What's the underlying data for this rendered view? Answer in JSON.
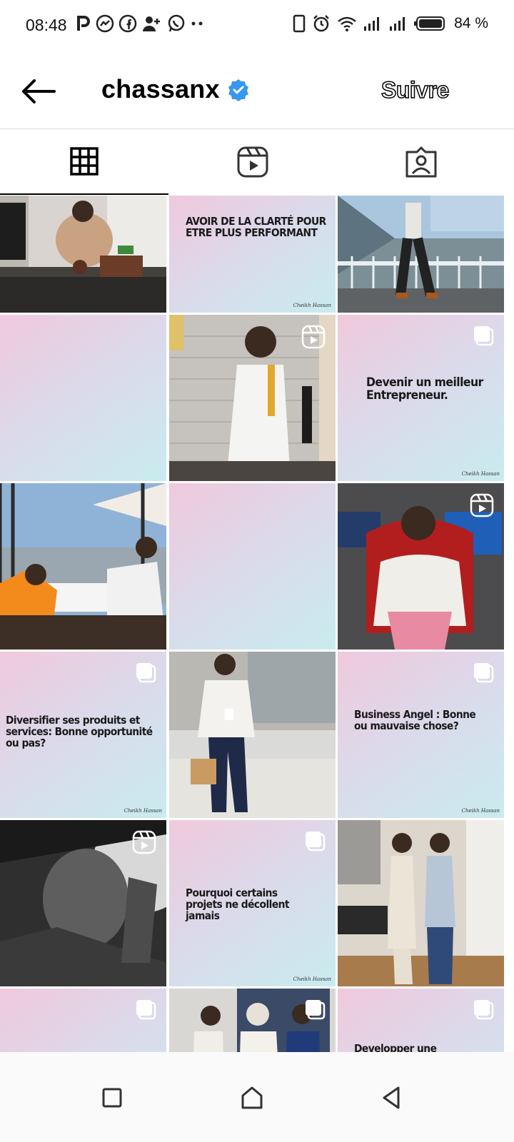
{
  "status_bar": {
    "time": "08:48",
    "battery_percent": "84 %",
    "left_icons": [
      "parking-app-icon",
      "messenger-icon",
      "facebook-icon",
      "add-contact-icon",
      "whatsapp-icon",
      "more-dots-icon"
    ],
    "right_icons": [
      "vibrate-icon",
      "alarm-icon",
      "wifi-icon",
      "signal-icon",
      "signal-icon",
      "battery-icon"
    ]
  },
  "header": {
    "username": "chassanx",
    "verified": true,
    "follow_label": "Suivre"
  },
  "tabs": [
    {
      "name": "tab-posts",
      "icon": "grid-icon",
      "active": true
    },
    {
      "name": "tab-reels",
      "icon": "reels-icon",
      "active": false
    },
    {
      "name": "tab-tagged",
      "icon": "tagged-icon",
      "active": false
    }
  ],
  "grid": {
    "posts": [
      {
        "kind": "photo",
        "subject": "man at office desk"
      },
      {
        "kind": "card",
        "text": "AVOIR DE LA CLARTÉ POUR ETRE PLUS PERFORMANT",
        "signature": "Cheikh Hassan"
      },
      {
        "kind": "photo",
        "subject": "man walking on bridge"
      },
      {
        "kind": "card",
        "text": "",
        "signature": ""
      },
      {
        "kind": "reel",
        "subject": "man in white outfit with microphone"
      },
      {
        "kind": "card",
        "text": "Devenir un meilleur Entrepreneur.",
        "signature": "Cheikh Hassan",
        "multi": true
      },
      {
        "kind": "photo",
        "subject": "two men at restaurant terrace"
      },
      {
        "kind": "card",
        "text": "",
        "signature": ""
      },
      {
        "kind": "reel",
        "subject": "man seated in gaming chair"
      },
      {
        "kind": "card",
        "text": "Diversifier ses produits et services: Bonne opportunité ou pas?",
        "signature": "Cheikh Hassan",
        "multi": true
      },
      {
        "kind": "photo",
        "subject": "man with badge at event"
      },
      {
        "kind": "card",
        "text": "Business Angel : Bonne ou mauvaise chose?",
        "signature": "Cheikh Hassan",
        "multi": true
      },
      {
        "kind": "reel",
        "subject": "black and white portrait"
      },
      {
        "kind": "card",
        "text": "Pourquoi certains projets ne décollent jamais",
        "signature": "Cheikh Hassan",
        "multi": true
      },
      {
        "kind": "photo",
        "subject": "two men in office"
      },
      {
        "kind": "card",
        "text": "",
        "signature": "",
        "multi": true
      },
      {
        "kind": "photo",
        "subject": "three people at event",
        "multi": true
      },
      {
        "kind": "card",
        "text": "Developper une entreprise",
        "signature": "",
        "multi": true
      }
    ]
  },
  "navbar": {
    "buttons": [
      "recent-apps-icon",
      "home-icon",
      "back-icon"
    ]
  }
}
